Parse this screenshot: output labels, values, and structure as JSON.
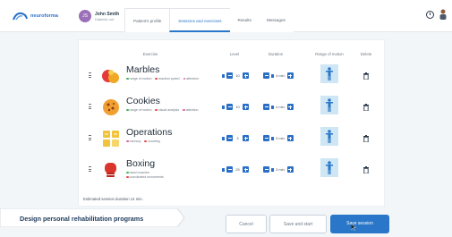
{
  "app": {
    "logo_text": "neuroforma"
  },
  "user": {
    "initials": "JS",
    "name": "John Smith",
    "subtitle": "Diabetic out"
  },
  "tabs": [
    {
      "label": "Patient's profile",
      "active": false
    },
    {
      "label": "Sessions and exercises",
      "active": true
    },
    {
      "label": "Results",
      "active": false
    },
    {
      "label": "Messages",
      "active": false
    }
  ],
  "columns": {
    "exercise": "Exercise",
    "level": "Level",
    "duration": "Duration",
    "range": "Range of motion",
    "delete": "Delete"
  },
  "exercises": [
    {
      "name": "Marbles",
      "tags": [
        {
          "label": "range of motion",
          "color": "#41b35f"
        },
        {
          "label": "reaction speed",
          "color": "#e84848"
        },
        {
          "label": "attention",
          "color": "#e063a6"
        }
      ],
      "level": "10",
      "duration": "4 min.",
      "icon": "marbles-icon"
    },
    {
      "name": "Cookies",
      "tags": [
        {
          "label": "range of motion",
          "color": "#41b35f"
        },
        {
          "label": "visual analysis",
          "color": "#e84848"
        },
        {
          "label": "attention",
          "color": "#e063a6"
        }
      ],
      "level": "10",
      "duration": "4 min.",
      "icon": "cookie-icon"
    },
    {
      "name": "Operations",
      "tags": [
        {
          "label": "memory",
          "color": "#e063a6"
        },
        {
          "label": "counting",
          "color": "#e84848"
        }
      ],
      "level": "3",
      "duration": "3 min.",
      "icon": "operations-icon"
    },
    {
      "name": "Boxing",
      "tags": [
        {
          "label": "hand muscles",
          "color": "#41b35f"
        },
        {
          "label": "coordinated movements",
          "color": "#e84848"
        }
      ],
      "level": "25",
      "duration": "3 min.",
      "icon": "boxing-glove-icon"
    }
  ],
  "estimate": "Estimated session duration 14 min.",
  "banner": "Design personal rehabilitation programs",
  "buttons": {
    "cancel": "Cancel",
    "save_start": "Save and start",
    "save_session": "Save session"
  },
  "colors": {
    "accent": "#2a77c9",
    "rom_bg": "#cfe6f5"
  }
}
